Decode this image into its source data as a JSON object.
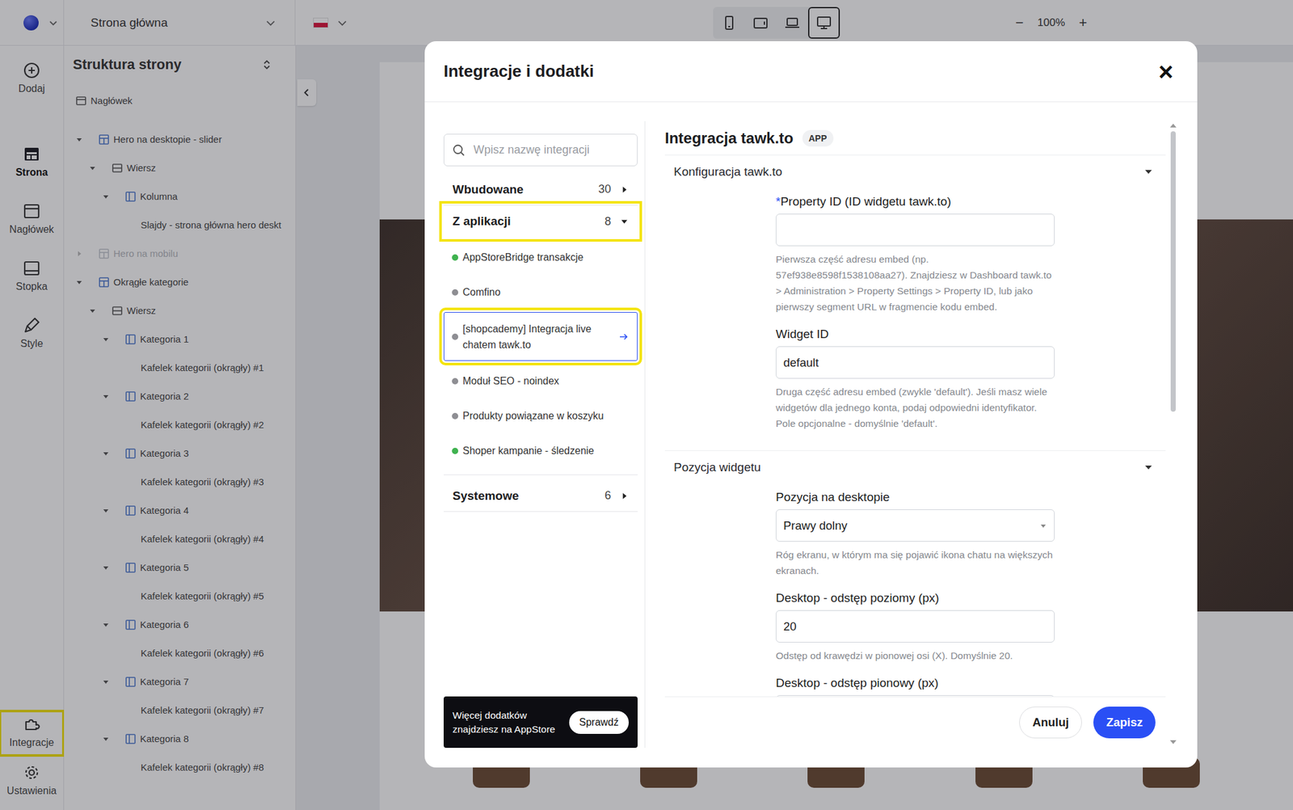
{
  "topbar": {
    "page_select": "Strona główna",
    "language": {
      "flag": "pl"
    },
    "devices": [
      {
        "kind": "mobile",
        "selected": false
      },
      {
        "kind": "tablet",
        "selected": false
      },
      {
        "kind": "laptop",
        "selected": false
      },
      {
        "kind": "desktop",
        "selected": true
      }
    ],
    "zoom": {
      "minus": "−",
      "value": "100%",
      "plus": "+"
    }
  },
  "rail": {
    "top": [
      {
        "label": "Dodaj",
        "kind": "add",
        "selected": false,
        "highlighted": false
      },
      {
        "label": "Strona",
        "kind": "page",
        "selected": true,
        "highlighted": false
      },
      {
        "label": "Nagłówek",
        "kind": "header",
        "selected": false,
        "highlighted": false
      },
      {
        "label": "Stopka",
        "kind": "footer",
        "selected": false,
        "highlighted": false
      },
      {
        "label": "Style",
        "kind": "style",
        "selected": false,
        "highlighted": false
      }
    ],
    "bottom": [
      {
        "label": "Integracje",
        "kind": "integrations",
        "selected": false,
        "highlighted": true
      },
      {
        "label": "Ustawienia",
        "kind": "settings",
        "selected": false,
        "highlighted": false
      }
    ]
  },
  "structure": {
    "title": "Struktura strony",
    "items": [
      {
        "label": "Nagłówek",
        "depth": 0,
        "kind": "header",
        "hidden": false
      },
      {
        "label": "Hero na desktopie - slider",
        "depth": 0,
        "kind": "section",
        "expanded": true,
        "hidden": false
      },
      {
        "label": "Wiersz",
        "depth": 1,
        "kind": "row",
        "expanded": true,
        "hidden": false
      },
      {
        "label": "Kolumna",
        "depth": 2,
        "kind": "column",
        "expanded": true,
        "hidden": false
      },
      {
        "label": "Slajdy - strona główna hero deskt",
        "depth": 3,
        "kind": "element",
        "hidden": false
      },
      {
        "label": "Hero na mobilu",
        "depth": 0,
        "kind": "section",
        "expanded": false,
        "hidden": true
      },
      {
        "label": "Okrągłe kategorie",
        "depth": 0,
        "kind": "section",
        "expanded": true,
        "hidden": false
      },
      {
        "label": "Wiersz",
        "depth": 1,
        "kind": "row",
        "expanded": true,
        "hidden": false
      },
      {
        "label": "Kategoria 1",
        "depth": 2,
        "kind": "column",
        "expanded": true,
        "hidden": false
      },
      {
        "label": "Kafelek kategorii (okrągły) #1",
        "depth": 3,
        "kind": "element",
        "hidden": false
      },
      {
        "label": "Kategoria 2",
        "depth": 2,
        "kind": "column",
        "expanded": true,
        "hidden": false
      },
      {
        "label": "Kafelek kategorii (okrągły) #2",
        "depth": 3,
        "kind": "element",
        "hidden": false
      },
      {
        "label": "Kategoria 3",
        "depth": 2,
        "kind": "column",
        "expanded": true,
        "hidden": false
      },
      {
        "label": "Kafelek kategorii (okrągły) #3",
        "depth": 3,
        "kind": "element",
        "hidden": false
      },
      {
        "label": "Kategoria 4",
        "depth": 2,
        "kind": "column",
        "expanded": true,
        "hidden": false
      },
      {
        "label": "Kafelek kategorii (okrągły) #4",
        "depth": 3,
        "kind": "element",
        "hidden": false
      },
      {
        "label": "Kategoria 5",
        "depth": 2,
        "kind": "column",
        "expanded": true,
        "hidden": false
      },
      {
        "label": "Kafelek kategorii (okrągły) #5",
        "depth": 3,
        "kind": "element",
        "hidden": false
      },
      {
        "label": "Kategoria 6",
        "depth": 2,
        "kind": "column",
        "expanded": true,
        "hidden": false
      },
      {
        "label": "Kafelek kategorii (okrągły) #6",
        "depth": 3,
        "kind": "element",
        "hidden": false
      },
      {
        "label": "Kategoria 7",
        "depth": 2,
        "kind": "column",
        "expanded": true,
        "hidden": false
      },
      {
        "label": "Kafelek kategorii (okrągły) #7",
        "depth": 3,
        "kind": "element",
        "hidden": false
      },
      {
        "label": "Kategoria 8",
        "depth": 2,
        "kind": "column",
        "expanded": true,
        "hidden": false
      },
      {
        "label": "Kafelek kategorii (okrągły) #8",
        "depth": 3,
        "kind": "element",
        "hidden": false
      }
    ]
  },
  "modal": {
    "title": "Integracje i dodatki",
    "close": "×",
    "search": {
      "placeholder": "Wpisz nazwę integracji"
    },
    "categories": [
      {
        "label": "Wbudowane",
        "count": "30",
        "expanded": false,
        "highlighted": false,
        "items": []
      },
      {
        "label": "Z aplikacji",
        "count": "8",
        "expanded": true,
        "highlighted": true,
        "items": [
          {
            "label": "AppStoreBridge transakcje",
            "color": "#3fb24f",
            "selected": false,
            "highlighted": false
          },
          {
            "label": "Comfino",
            "color": "#8e8e93",
            "selected": false,
            "highlighted": false
          },
          {
            "label": "[shopcademy] Integracja live chatem tawk.to",
            "color": "#8e8e93",
            "selected": true,
            "highlighted": true
          },
          {
            "label": "Moduł SEO - noindex",
            "color": "#8e8e93",
            "selected": false,
            "highlighted": false
          },
          {
            "label": "Produkty powiązane w koszyku",
            "color": "#8e8e93",
            "selected": false,
            "highlighted": false
          },
          {
            "label": "Shoper kampanie - śledzenie",
            "color": "#3fb24f",
            "selected": false,
            "highlighted": false
          }
        ]
      },
      {
        "label": "Systemowe",
        "count": "6",
        "expanded": false,
        "highlighted": false,
        "items": []
      }
    ],
    "promo": {
      "lines": [
        "Więcej dodatków",
        "znajdziesz na AppStore"
      ],
      "button": "Sprawdź"
    },
    "detail": {
      "title": "Integracja tawk.to",
      "badge": "APP",
      "sections": [
        {
          "title": "Konfiguracja tawk.to",
          "expanded": true,
          "fields": [
            {
              "kind": "text",
              "label": "Property ID (ID widgetu tawk.to)",
              "required_mark": "*",
              "value": "",
              "help": "Pierwsza część adresu embed (np. 57ef938e8598f1538108aa27). Znajdziesz w Dashboard tawk.to > Administration > Property Settings > Property ID, lub jako pierwszy segment URL w fragmencie kodu embed."
            },
            {
              "kind": "text",
              "label": "Widget ID",
              "value": "default",
              "help": "Druga część adresu embed (zwykle 'default'). Jeśli masz wiele widgetów dla jednego konta, podaj odpowiedni identyfikator. Pole opcjonalne - domyślnie 'default'."
            }
          ]
        },
        {
          "title": "Pozycja widgetu",
          "expanded": true,
          "fields": [
            {
              "kind": "select",
              "label": "Pozycja na desktopie",
              "value": "Prawy dolny",
              "help": "Róg ekranu, w którym ma się pojawić ikona chatu na większych ekranach."
            },
            {
              "kind": "text",
              "label": "Desktop - odstęp poziomy (px)",
              "value": "20",
              "help": "Odstęp od krawędzi w pionowej osi (X). Domyślnie 20."
            },
            {
              "kind": "text",
              "label": "Desktop - odstęp pionowy (px)",
              "value": "",
              "help": ""
            }
          ]
        }
      ]
    },
    "buttons": {
      "cancel": "Anuluj",
      "save": "Zapisz"
    }
  }
}
